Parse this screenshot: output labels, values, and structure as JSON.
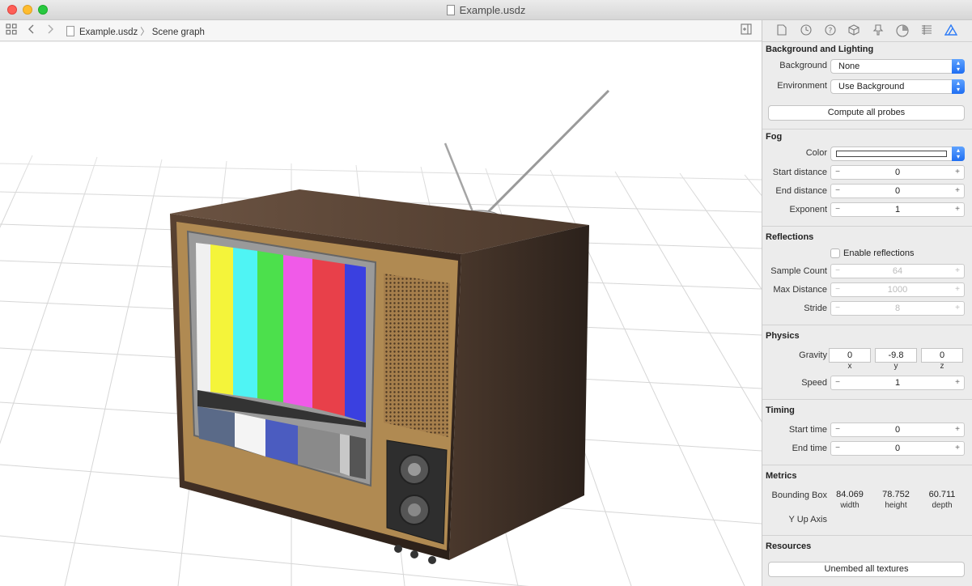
{
  "window": {
    "title": "Example.usdz"
  },
  "toolbar": {
    "file": "Example.usdz",
    "separator": "〉",
    "crumb": "Scene graph"
  },
  "inspector": {
    "tabs": [
      "file-icon",
      "clock-icon",
      "help-icon",
      "cube-icon",
      "node-icon",
      "material-icon",
      "layers-icon",
      "scene-icon"
    ],
    "background_lighting": {
      "title": "Background and Lighting",
      "background_label": "Background",
      "background_value": "None",
      "environment_label": "Environment",
      "environment_value": "Use Background",
      "compute_button": "Compute all probes"
    },
    "fog": {
      "title": "Fog",
      "color_label": "Color",
      "start_label": "Start distance",
      "start_value": "0",
      "end_label": "End distance",
      "end_value": "0",
      "exponent_label": "Exponent",
      "exponent_value": "1"
    },
    "reflections": {
      "title": "Reflections",
      "enable_label": "Enable reflections",
      "sample_label": "Sample Count",
      "sample_value": "64",
      "maxdist_label": "Max Distance",
      "maxdist_value": "1000",
      "stride_label": "Stride",
      "stride_value": "8"
    },
    "physics": {
      "title": "Physics",
      "gravity_label": "Gravity",
      "gravity_x": "0",
      "gravity_y": "-9.8",
      "gravity_z": "0",
      "x_label": "x",
      "y_label": "y",
      "z_label": "z",
      "speed_label": "Speed",
      "speed_value": "1"
    },
    "timing": {
      "title": "Timing",
      "start_label": "Start time",
      "start_value": "0",
      "end_label": "End time",
      "end_value": "0"
    },
    "metrics": {
      "title": "Metrics",
      "bbox_label": "Bounding Box",
      "width_value": "84.069",
      "height_value": "78.752",
      "depth_value": "60.711",
      "width_label": "width",
      "height_label": "height",
      "depth_label": "depth",
      "axis_label": "Y Up Axis"
    },
    "resources": {
      "title": "Resources",
      "unembed_button": "Unembed all textures"
    }
  },
  "colors": {
    "accent": "#2e7cf6",
    "popup_arrow": "#1f6ef2",
    "close": "#fe5f57",
    "minimize": "#febc2e",
    "maximize": "#28c840"
  }
}
